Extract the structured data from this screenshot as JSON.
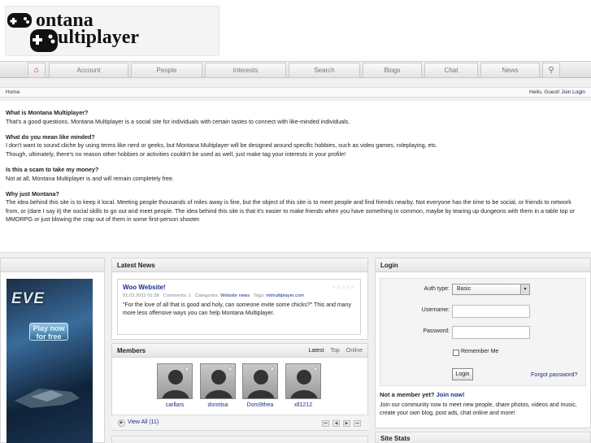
{
  "nav": {
    "tabs": [
      "Account",
      "People",
      "Interests",
      "Search",
      "Blogs",
      "Chat",
      "News"
    ]
  },
  "breadcrumb": {
    "home": "Home"
  },
  "greeting": {
    "text": "Hello, Guest!",
    "join": "Join",
    "login": "Login"
  },
  "intro": {
    "q1": "What is Montana Multiplayer?",
    "a1": "That's a good questions, Montana Multiplayer is a social site for individuals with certain tastes to connect with like-minded individuals.",
    "q2": "What do you mean like minded?",
    "a2a": "I don't want to sound cliche by using terms like nerd or geeks, but Montana Multiplayer will be designed around specific hobbies, such as video games, roleplaying, etc.",
    "a2b": "Though, ultimately, there's no reason other hobbies or activities couldn't be used as well, just make tag your interests in your profile!",
    "q3": "Is this a scam to take my money?",
    "a3": "Not at all, Montana Multiplayer is and will remain completely free.",
    "q4": "Why just Montana?",
    "a4": "The idea behind this site is to keep it local. Meeting people thousands of miles away is fine, but the object of this site is to meet people and find friends nearby. Not everyone has the time to be social, or friends to network from, or (dare I say it) the social skills to go out and meet people. The idea behind this site is that it's easier to make friends when you have something in common, maybe by tearing up dungeons with them in a table top or MMORPG or just blowing the crap out of them in some first-person shooter."
  },
  "ad": {
    "title": "EVE",
    "button": "Play now for free"
  },
  "news": {
    "header": "Latest News",
    "title": "Woo Website!",
    "date": "01.02.2011 01:38",
    "comments": "Comments: 1",
    "categories_label": "Categories:",
    "category": "Website news",
    "tags_label": "Tags:",
    "tag": "mtmultiplayer.com",
    "body": "\"For the love of all that is good and holy, can someone invite some chicks?\" This and many more less offensive ways you can help Montana Multiplayer."
  },
  "members": {
    "header": "Members",
    "tabs": [
      "Latest",
      "Top",
      "Online"
    ],
    "list": [
      "carllars",
      "dorotisa",
      "Doro9thea",
      "xll1212"
    ],
    "view_all": "View All (11)"
  },
  "login": {
    "header": "Login",
    "auth_label": "Auth type:",
    "auth_value": "Basic",
    "username_label": "Username:",
    "password_label": "Password:",
    "remember": "Remember Me",
    "button": "Login",
    "forgot": "Forgot password?",
    "not_member": "Not a member yet?",
    "join_now": "Join now!",
    "promo": "Join our community now to meet new people, share photos, videos and music, create your own blog, post ads, chat online and more!"
  },
  "site_stats": {
    "header": "Site Stats"
  },
  "colors": {
    "link": "#1b2d8a",
    "accent": "#1b2d8a"
  }
}
